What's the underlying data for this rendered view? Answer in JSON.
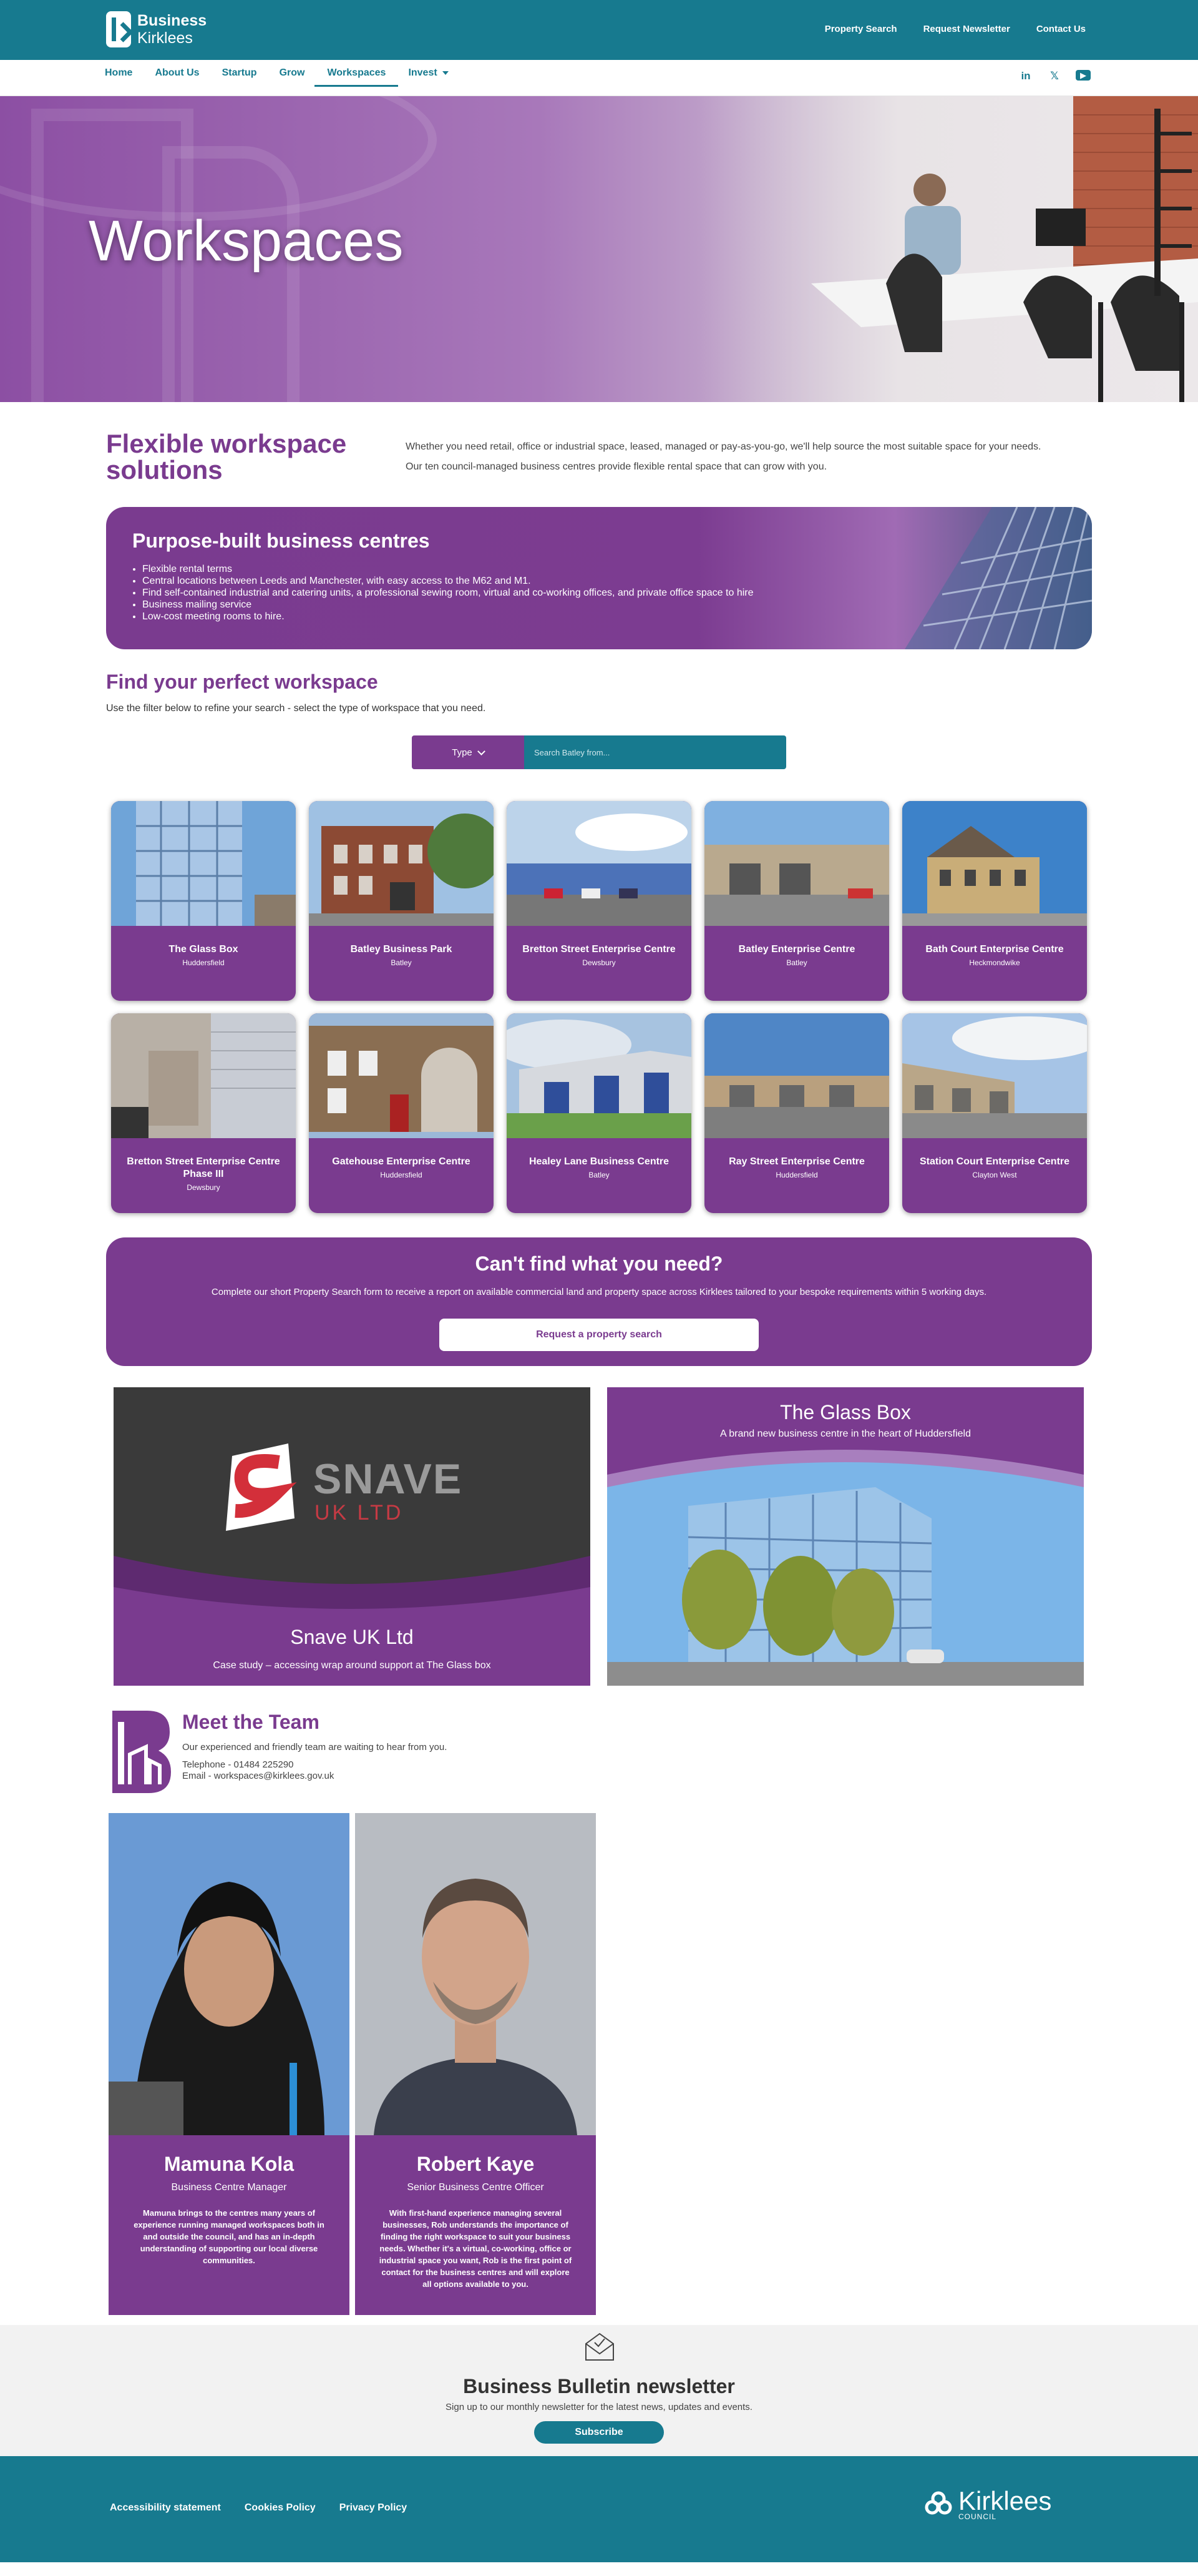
{
  "brand": {
    "name_line1": "Business",
    "name_line2": "Kirklees"
  },
  "top_links": [
    "Property Search",
    "Request Newsletter",
    "Contact Us"
  ],
  "nav": {
    "items": [
      "Home",
      "About Us",
      "Startup",
      "Grow",
      "Workspaces",
      "Invest"
    ],
    "active": "Workspaces"
  },
  "social": {
    "linkedin": "in",
    "x": "𝕏",
    "youtube": "▶"
  },
  "hero": {
    "title": "Workspaces"
  },
  "intro": {
    "title": "Flexible workspace solutions",
    "p1": "Whether you need retail, office or industrial space, leased, managed or pay-as-you-go, we'll help source the most suitable space for your needs.",
    "p2": "Our ten council-managed business centres provide flexible rental space that can grow with you."
  },
  "purpose": {
    "title": "Purpose-built business centres",
    "bullets": [
      "Flexible rental terms",
      "Central locations between Leeds and Manchester, with easy access to the M62 and M1.",
      "Find self-contained industrial and catering units, a professional sewing room, virtual and co-working offices, and private office space to hire",
      "Business mailing service",
      "Low-cost meeting rooms to hire."
    ]
  },
  "find": {
    "title": "Find your perfect workspace",
    "text": "Use the filter below to refine your search - select the type of workspace that you need.",
    "type_label": "Type",
    "search_placeholder": "Search Batley from..."
  },
  "workspaces": [
    {
      "name": "The Glass Box",
      "location": "Huddersfield"
    },
    {
      "name": "Batley Business Park",
      "location": "Batley"
    },
    {
      "name": "Bretton Street Enterprise Centre",
      "location": "Dewsbury"
    },
    {
      "name": "Batley Enterprise Centre",
      "location": "Batley"
    },
    {
      "name": "Bath Court Enterprise Centre",
      "location": "Heckmondwike"
    },
    {
      "name": "Bretton Street Enterprise Centre Phase III",
      "location": "Dewsbury"
    },
    {
      "name": "Gatehouse Enterprise Centre",
      "location": "Huddersfield"
    },
    {
      "name": "Healey Lane Business Centre",
      "location": "Batley"
    },
    {
      "name": "Ray Street Enterprise Centre",
      "location": "Huddersfield"
    },
    {
      "name": "Station Court Enterprise Centre",
      "location": "Clayton West"
    }
  ],
  "cant_find": {
    "title": "Can't find what you need?",
    "text": "Complete our short Property Search form to receive a report on available commercial land and property space across Kirklees tailored to your bespoke requirements within 5 working days.",
    "button": "Request a property search"
  },
  "promos": [
    {
      "logo_main": "SNAVE",
      "logo_sub": "UK LTD",
      "title": "Snave UK Ltd",
      "subtitle": "Case study – accessing wrap around support at The Glass box"
    },
    {
      "title": "The Glass Box",
      "subtitle": "A brand new business centre in the heart of Huddersfield"
    }
  ],
  "team": {
    "title": "Meet the Team",
    "intro": "Our experienced and friendly team are waiting to hear from you.",
    "telephone": "Telephone - 01484 225290",
    "email": "Email - workspaces@kirklees.gov.uk",
    "members": [
      {
        "name": "Mamuna Kola",
        "role": "Business Centre Manager",
        "bio": "Mamuna brings to the centres many years of experience running managed workspaces both in and outside the council, and has an in-depth understanding of supporting our local diverse communities."
      },
      {
        "name": "Robert Kaye",
        "role": "Senior Business Centre Officer",
        "bio": "With first-hand experience managing several businesses, Rob understands the importance of finding the right workspace to suit your business needs. Whether it's a virtual, co-working, office or industrial space you want, Rob is the first point of contact for the business centres and will explore all options available to you."
      }
    ]
  },
  "newsletter": {
    "title": "Business Bulletin newsletter",
    "text": "Sign up to our monthly newsletter for the latest news, updates and events.",
    "button": "Subscribe"
  },
  "footer": {
    "links": [
      "Accessibility statement",
      "Cookies Policy",
      "Privacy Policy"
    ],
    "council_name": "Kirklees",
    "council_sub": "COUNCIL"
  },
  "colors": {
    "teal": "#177a8f",
    "purple": "#7a3b8f"
  }
}
